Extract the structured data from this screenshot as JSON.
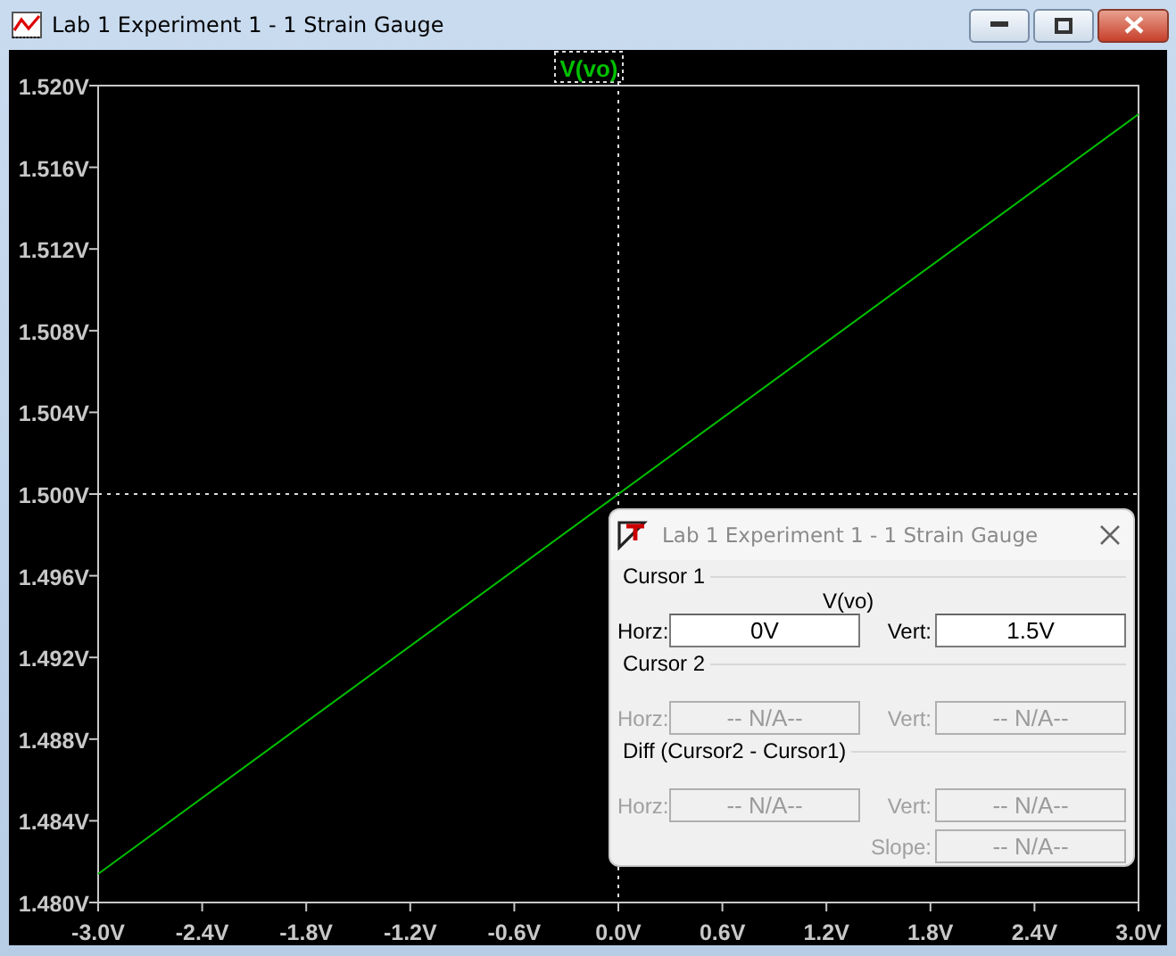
{
  "window": {
    "title": "Lab 1 Experiment 1 - 1 Strain Gauge"
  },
  "plot": {
    "chart_data": {
      "type": "line",
      "x": [
        -3.0,
        3.0
      ],
      "series": [
        {
          "name": "V(vo)",
          "color": "#00c000",
          "values": [
            1.4814,
            1.5186
          ]
        }
      ],
      "xlim": [
        -3.0,
        3.0
      ],
      "ylim": [
        1.48,
        1.52
      ],
      "xticks": [
        {
          "value": -3.0,
          "label": "-3.0V"
        },
        {
          "value": -2.4,
          "label": "-2.4V"
        },
        {
          "value": -1.8,
          "label": "-1.8V"
        },
        {
          "value": -1.2,
          "label": "-1.2V"
        },
        {
          "value": -0.6,
          "label": "-0.6V"
        },
        {
          "value": 0.0,
          "label": "0.0V"
        },
        {
          "value": 0.6,
          "label": "0.6V"
        },
        {
          "value": 1.2,
          "label": "1.2V"
        },
        {
          "value": 1.8,
          "label": "1.8V"
        },
        {
          "value": 2.4,
          "label": "2.4V"
        },
        {
          "value": 3.0,
          "label": "3.0V"
        }
      ],
      "yticks": [
        {
          "value": 1.48,
          "label": "1.480V"
        },
        {
          "value": 1.484,
          "label": "1.484V"
        },
        {
          "value": 1.488,
          "label": "1.488V"
        },
        {
          "value": 1.492,
          "label": "1.492V"
        },
        {
          "value": 1.496,
          "label": "1.496V"
        },
        {
          "value": 1.5,
          "label": "1.500V"
        },
        {
          "value": 1.504,
          "label": "1.504V"
        },
        {
          "value": 1.508,
          "label": "1.508V"
        },
        {
          "value": 1.512,
          "label": "1.512V"
        },
        {
          "value": 1.516,
          "label": "1.516V"
        },
        {
          "value": 1.52,
          "label": "1.520V"
        }
      ],
      "ref_lines": [
        {
          "axis": "x",
          "value": 0.0
        },
        {
          "axis": "y",
          "value": 1.5
        }
      ]
    }
  },
  "cursor_dialog": {
    "title": "Lab 1 Experiment 1 - 1 Strain Gauge",
    "sections": [
      {
        "heading": "Cursor 1",
        "trace": "V(vo)",
        "fields": [
          {
            "label": "Horz:",
            "value": "0V",
            "disabled": false
          },
          {
            "label": "Vert:",
            "value": "1.5V",
            "disabled": false
          }
        ]
      },
      {
        "heading": "Cursor 2",
        "fields": [
          {
            "label": "Horz:",
            "value": "-- N/A--",
            "disabled": true
          },
          {
            "label": "Vert:",
            "value": "-- N/A--",
            "disabled": true
          }
        ]
      },
      {
        "heading": "Diff (Cursor2 - Cursor1)",
        "fields": [
          {
            "label": "Horz:",
            "value": "-- N/A--",
            "disabled": true
          },
          {
            "label": "Vert:",
            "value": "-- N/A--",
            "disabled": true
          },
          {
            "label": "Slope:",
            "value": "-- N/A--",
            "disabled": true
          }
        ]
      }
    ]
  }
}
